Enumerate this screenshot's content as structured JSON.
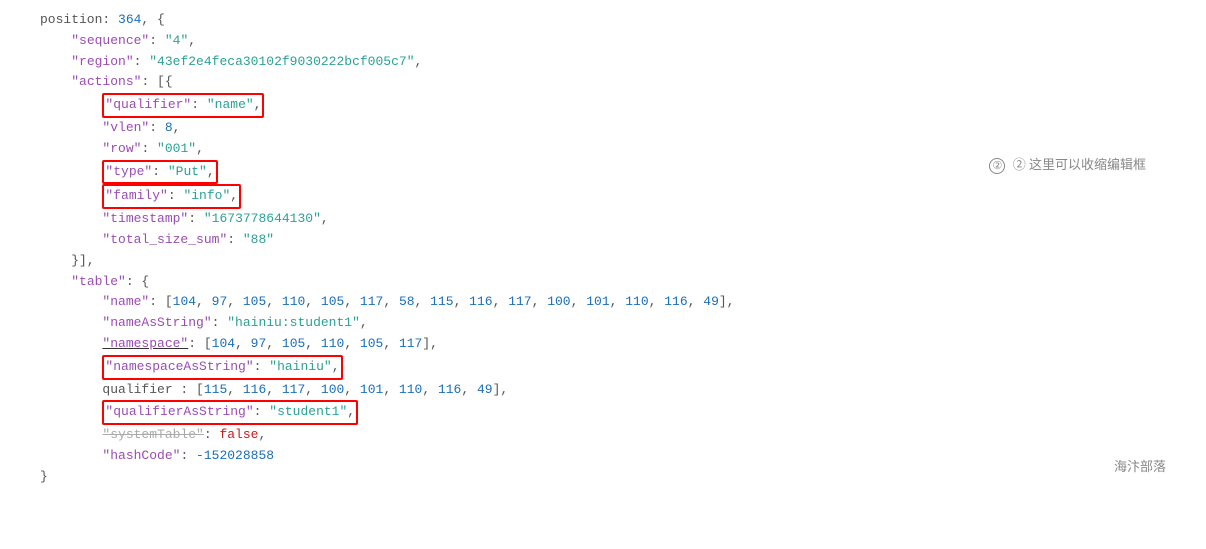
{
  "annotation1": "② 这里可以收缩编辑框",
  "annotation2": "海汴部落",
  "lines": [
    {
      "indent": 0,
      "content": "position: 364,  {"
    },
    {
      "indent": 1,
      "content": "\"sequence\": \"4\","
    },
    {
      "indent": 1,
      "content": "\"region\": \"43ef2e4feca30102f9030222bcf005c7\","
    },
    {
      "indent": 1,
      "content": "\"actions\": [{"
    },
    {
      "indent": 2,
      "content": "\"qualifier\": \"name\",",
      "highlight": true
    },
    {
      "indent": 2,
      "content": "\"vlen\": 8,"
    },
    {
      "indent": 2,
      "content": "\"row\": \"001\","
    },
    {
      "indent": 2,
      "content": "\"type\": \"Put\",",
      "highlight": true
    },
    {
      "indent": 2,
      "content": "\"family\": \"info\",",
      "highlight": true
    },
    {
      "indent": 2,
      "content": "\"timestamp\": \"1673778644130\","
    },
    {
      "indent": 2,
      "content": "\"total_size_sum\": \"88\""
    },
    {
      "indent": 1,
      "content": "}],"
    },
    {
      "indent": 1,
      "content": "\"table\": {"
    },
    {
      "indent": 2,
      "content": "\"name\": [104, 97, 105, 110, 105, 117, 58, 115, 116, 117, 100, 101, 110, 116, 49],"
    },
    {
      "indent": 2,
      "content": "\"nameAsString\": \"hainiu:student1\","
    },
    {
      "indent": 2,
      "content": "\"namespace\": [104, 97, 105, 110, 105, 117],",
      "underline": true
    },
    {
      "indent": 2,
      "content": "\"namespaceAsString\": \"hainiu\",",
      "highlight": true
    },
    {
      "indent": 2,
      "content": "qualifier : [115, 116, 117, 100, 101, 110, 116, 49],"
    },
    {
      "indent": 2,
      "content": "\"qualifierAsString\": \"student1\",",
      "highlight": true
    },
    {
      "indent": 2,
      "content": "\"systemTable\": false,"
    },
    {
      "indent": 2,
      "content": "\"hashCode\": -152028858"
    },
    {
      "indent": 0,
      "content": "}"
    }
  ]
}
